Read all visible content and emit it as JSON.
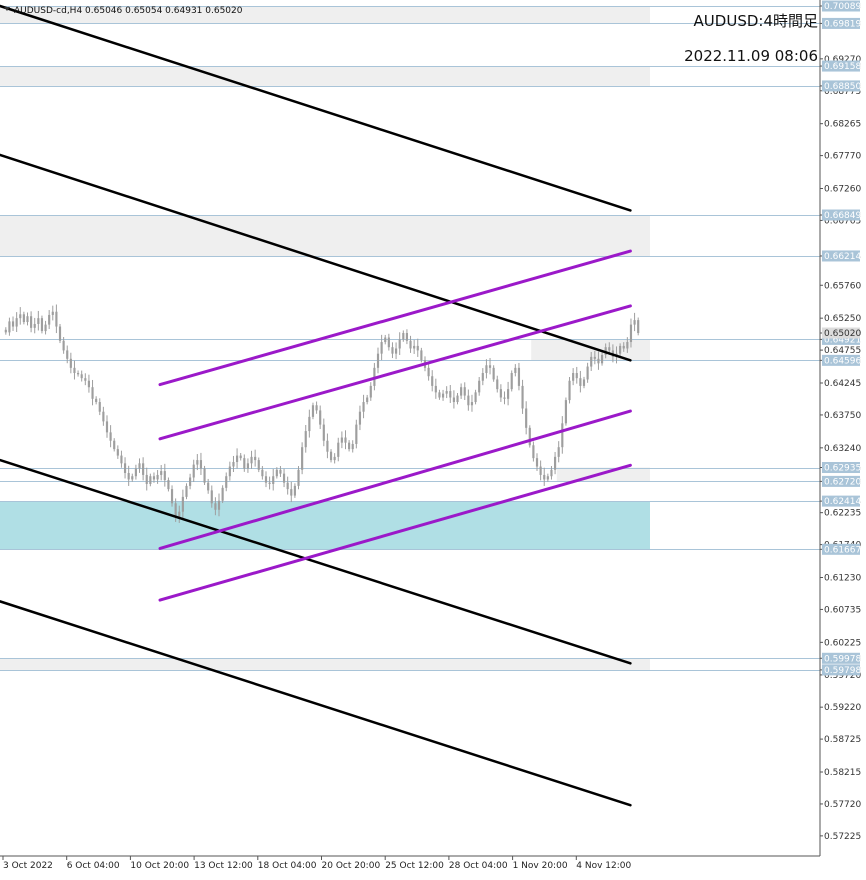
{
  "header": {
    "symbol_line": "AUDUSD-cd,H4  0.65046 0.65054 0.64931 0.65020"
  },
  "overlay": {
    "title": "AUDUSD:4時間足",
    "datetime": "2022.11.09 08:06"
  },
  "colors": {
    "background": "#ffffff",
    "candle": "#9e9e9e",
    "zone_gray": "#efefef",
    "zone_cyan": "#b0dfe5",
    "level_line": "#a9c4d8",
    "level_tag_bg": "#a9c4d8",
    "current_tag_bg": "#dcdcdc",
    "black_channel": "#000000",
    "purple_channel": "#9b19c9",
    "axis": "#555555"
  },
  "price_axis": {
    "min": 0.56975,
    "max": 0.70089,
    "ticks": [
      "0.70089",
      "0.69819",
      "0.69270",
      "0.69158",
      "0.68850",
      "0.68775",
      "0.68265",
      "0.67770",
      "0.67260",
      "0.66849",
      "0.66765",
      "0.66214",
      "0.65760",
      "0.65250",
      "0.65020",
      "0.64921",
      "0.64755",
      "0.64596",
      "0.64245",
      "0.63750",
      "0.63240",
      "0.62935",
      "0.62720",
      "0.62414",
      "0.62235",
      "0.61740",
      "0.61667",
      "0.61230",
      "0.60735",
      "0.60225",
      "0.59978",
      "0.59798",
      "0.59720",
      "0.59220",
      "0.58725",
      "0.58215",
      "0.57720",
      "0.57225"
    ]
  },
  "time_axis": {
    "labels": [
      "3 Oct 2022",
      "6 Oct 04:00",
      "10 Oct 20:00",
      "13 Oct 12:00",
      "18 Oct 04:00",
      "20 Oct 20:00",
      "25 Oct 12:00",
      "28 Oct 04:00",
      "1 Nov 20:00",
      "4 Nov 12:00"
    ]
  },
  "levels": [
    {
      "value": 0.70089,
      "label": "0.70089"
    },
    {
      "value": 0.69819,
      "label": "0.69819"
    },
    {
      "value": 0.69158,
      "label": "0.69158"
    },
    {
      "value": 0.6885,
      "label": "0.68850"
    },
    {
      "value": 0.66849,
      "label": "0.66849"
    },
    {
      "value": 0.66214,
      "label": "0.66214"
    },
    {
      "value": 0.64921,
      "label": "0.64921"
    },
    {
      "value": 0.64596,
      "label": "0.64596"
    },
    {
      "value": 0.62935,
      "label": "0.62935"
    },
    {
      "value": 0.6272,
      "label": "0.62720"
    },
    {
      "value": 0.62414,
      "label": "0.62414"
    },
    {
      "value": 0.61667,
      "label": "0.61667"
    },
    {
      "value": 0.59978,
      "label": "0.59978"
    },
    {
      "value": 0.59798,
      "label": "0.59798"
    }
  ],
  "current_price": {
    "value": 0.6502,
    "label": "0.65020"
  },
  "zones": [
    {
      "kind": "gray",
      "top": 0.70089,
      "bottom": 0.69819
    },
    {
      "kind": "gray",
      "top": 0.69158,
      "bottom": 0.6885
    },
    {
      "kind": "gray",
      "top": 0.66849,
      "bottom": 0.66214
    },
    {
      "kind": "gray",
      "top": 0.64921,
      "bottom": 0.64596,
      "start_fraction": 0.83
    },
    {
      "kind": "gray",
      "top": 0.62935,
      "bottom": 0.6272,
      "start_fraction": 0.87
    },
    {
      "kind": "cyan",
      "top": 0.62414,
      "bottom": 0.61667
    },
    {
      "kind": "gray",
      "top": 0.59978,
      "bottom": 0.59798
    }
  ],
  "channels": {
    "black": [
      {
        "t1": 0.0,
        "p1": 0.70089,
        "t2": 0.985,
        "p2": 0.6692
      },
      {
        "t1": 0.0,
        "p1": 0.6778,
        "t2": 0.985,
        "p2": 0.64596
      },
      {
        "t1": 0.0,
        "p1": 0.6305,
        "t2": 0.985,
        "p2": 0.599
      },
      {
        "t1": 0.0,
        "p1": 0.6086,
        "t2": 0.985,
        "p2": 0.577
      }
    ],
    "purple": [
      {
        "t1": 0.25,
        "p1": 0.6422,
        "t2": 0.985,
        "p2": 0.6629
      },
      {
        "t1": 0.25,
        "p1": 0.6338,
        "t2": 0.985,
        "p2": 0.6544
      },
      {
        "t1": 0.25,
        "p1": 0.6168,
        "t2": 0.985,
        "p2": 0.6381
      },
      {
        "t1": 0.25,
        "p1": 0.6088,
        "t2": 0.985,
        "p2": 0.6297
      }
    ]
  },
  "chart_data": {
    "type": "candlestick",
    "symbol": "AUDUSD-cd",
    "timeframe": "H4",
    "ohlc_header": {
      "open": 0.65046,
      "high": 0.65054,
      "low": 0.64931,
      "close": 0.6502
    },
    "closes": [
      0.6503,
      0.652,
      0.6512,
      0.6525,
      0.6531,
      0.6519,
      0.6528,
      0.651,
      0.6516,
      0.6525,
      0.6505,
      0.6515,
      0.653,
      0.6535,
      0.6512,
      0.649,
      0.6475,
      0.6462,
      0.6448,
      0.644,
      0.6438,
      0.6432,
      0.6428,
      0.6418,
      0.64,
      0.6395,
      0.638,
      0.6365,
      0.6348,
      0.6335,
      0.6322,
      0.6312,
      0.63,
      0.6285,
      0.6275,
      0.628,
      0.6292,
      0.63,
      0.6282,
      0.6268,
      0.628,
      0.6275,
      0.6282,
      0.6288,
      0.6274,
      0.626,
      0.6238,
      0.6216,
      0.6225,
      0.6248,
      0.6265,
      0.6278,
      0.6298,
      0.6305,
      0.6292,
      0.627,
      0.6258,
      0.6238,
      0.6228,
      0.6242,
      0.6262,
      0.628,
      0.6295,
      0.6302,
      0.6312,
      0.6308,
      0.6292,
      0.63,
      0.631,
      0.6305,
      0.629,
      0.628,
      0.627,
      0.6268,
      0.628,
      0.629,
      0.6284,
      0.627,
      0.626,
      0.625,
      0.6265,
      0.629,
      0.6325,
      0.635,
      0.6372,
      0.639,
      0.6382,
      0.636,
      0.6335,
      0.6318,
      0.6305,
      0.631,
      0.6332,
      0.634,
      0.6332,
      0.6322,
      0.633,
      0.636,
      0.638,
      0.6395,
      0.6402,
      0.642,
      0.6448,
      0.647,
      0.6488,
      0.6495,
      0.648,
      0.647,
      0.6478,
      0.6492,
      0.6502,
      0.649,
      0.6478,
      0.6482,
      0.6475,
      0.646,
      0.6448,
      0.6435,
      0.642,
      0.641,
      0.6402,
      0.6408,
      0.6412,
      0.6402,
      0.6395,
      0.6405,
      0.6418,
      0.6405,
      0.639,
      0.6395,
      0.641,
      0.6428,
      0.644,
      0.6452,
      0.6448,
      0.643,
      0.6415,
      0.6402,
      0.64,
      0.6415,
      0.644,
      0.6448,
      0.642,
      0.6385,
      0.6355,
      0.6328,
      0.6308,
      0.6295,
      0.6282,
      0.6275,
      0.628,
      0.629,
      0.631,
      0.6325,
      0.6362,
      0.6398,
      0.6428,
      0.644,
      0.6432,
      0.642,
      0.643,
      0.645,
      0.6465,
      0.6462,
      0.6455,
      0.6468,
      0.648,
      0.6475,
      0.6465,
      0.647,
      0.6482,
      0.6478,
      0.6488,
      0.6515,
      0.6522,
      0.6502
    ]
  }
}
